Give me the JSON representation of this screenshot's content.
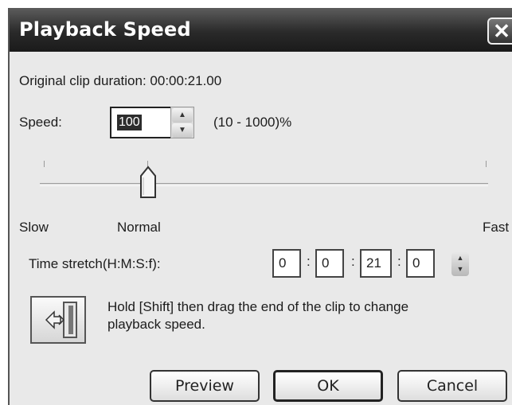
{
  "window": {
    "title": "Playback Speed",
    "close_glyph": "✕"
  },
  "info": {
    "duration_label": "Original clip duration: 00:00:21.00"
  },
  "speed": {
    "label": "Speed:",
    "value": "100",
    "range_hint": "(10 - 1000)%",
    "spin_up": "▲",
    "spin_down": "▼"
  },
  "slider": {
    "slow_label": "Slow",
    "normal_label": "Normal",
    "fast_label": "Fast",
    "position_fraction": 0.25
  },
  "time_stretch": {
    "label": "Time stretch(H:M:S:f):",
    "hours": "0",
    "minutes": "0",
    "seconds": "21",
    "frames": "0",
    "separator": ":"
  },
  "hint": {
    "text_line1": "Hold [Shift] then drag the end of the clip to change",
    "text_line2": "playback speed.",
    "icon": "drag-clip-icon"
  },
  "buttons": {
    "preview": "Preview",
    "ok": "OK",
    "cancel": "Cancel"
  }
}
